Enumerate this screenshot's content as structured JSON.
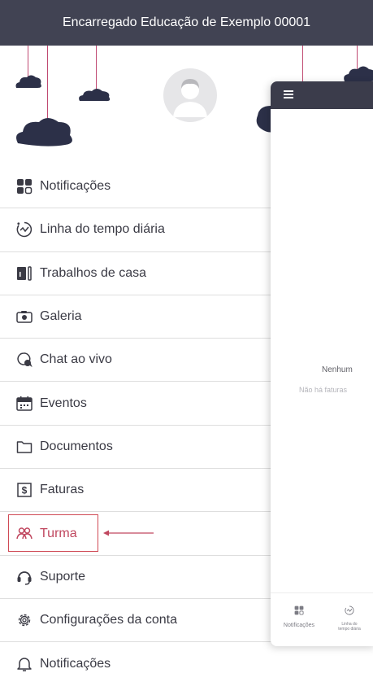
{
  "header": {
    "title": "Encarregado Educação de Exemplo 00001"
  },
  "menu": [
    {
      "label": "Notificações",
      "icon": "notifications-grid-icon"
    },
    {
      "label": "Linha do tempo diária",
      "icon": "daily-timeline-icon"
    },
    {
      "label": "Trabalhos de casa",
      "icon": "homework-icon"
    },
    {
      "label": "Galeria",
      "icon": "camera-icon"
    },
    {
      "label": "Chat ao vivo",
      "icon": "chat-icon"
    },
    {
      "label": "Eventos",
      "icon": "calendar-icon"
    },
    {
      "label": "Documentos",
      "icon": "folder-icon"
    },
    {
      "label": "Faturas",
      "icon": "invoice-icon"
    },
    {
      "label": "Turma",
      "icon": "people-icon",
      "highlighted": true
    },
    {
      "label": "Suporte",
      "icon": "headset-icon"
    },
    {
      "label": "Configurações da conta",
      "icon": "gear-icon"
    },
    {
      "label": "Notificações",
      "icon": "bell-icon"
    }
  ],
  "phone": {
    "empty_title": "Nenhum",
    "empty_subtitle": "Não há faturas",
    "tabs": [
      {
        "label": "Notificações",
        "icon": "notifications-grid-icon"
      },
      {
        "label": "Linha do tempo diária",
        "icon": "daily-timeline-icon"
      }
    ]
  },
  "colors": {
    "header_bg": "#414353",
    "accent": "#c0475f",
    "cloud": "#2c3048"
  }
}
